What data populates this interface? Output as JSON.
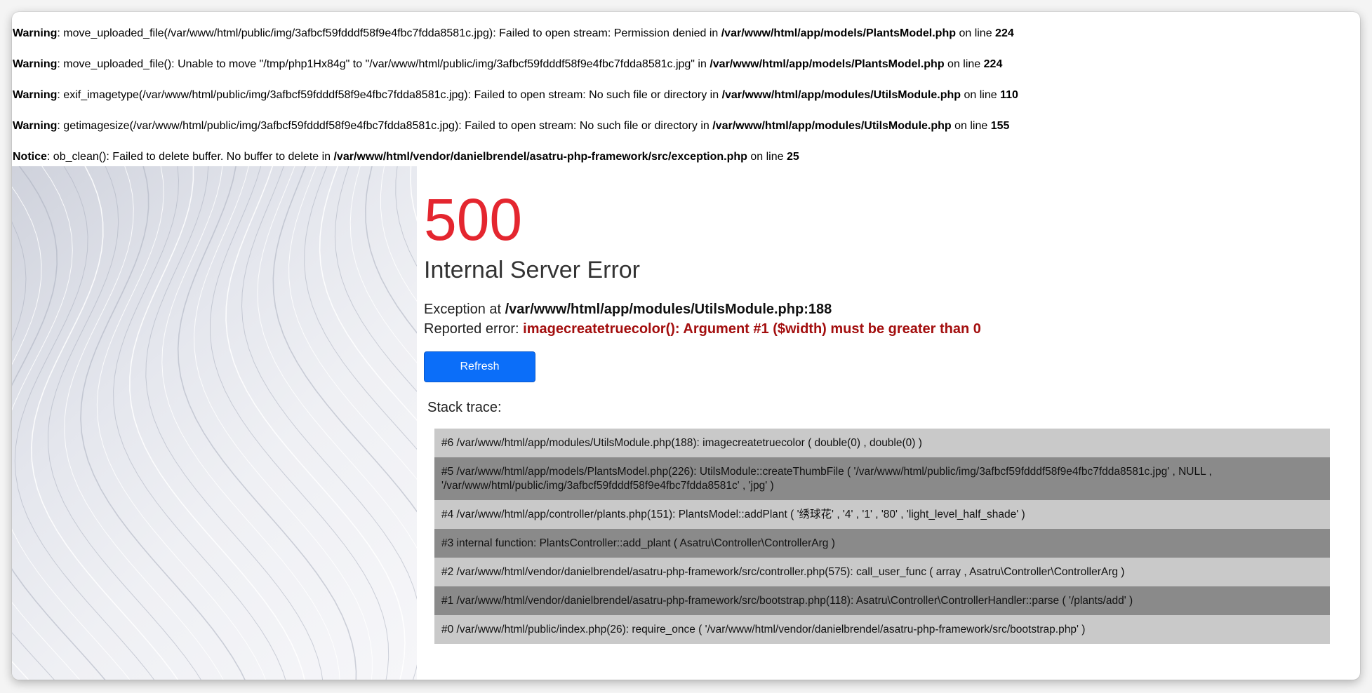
{
  "php_messages": [
    {
      "level": "Warning",
      "text": ": move_uploaded_file(/var/www/html/public/img/3afbcf59fdddf58f9e4fbc7fdda8581c.jpg): Failed to open stream: Permission denied in ",
      "file": "/var/www/html/app/models/PlantsModel.php",
      "on_line": " on line ",
      "line": "224"
    },
    {
      "level": "Warning",
      "text": ": move_uploaded_file(): Unable to move \"/tmp/php1Hx84g\" to \"/var/www/html/public/img/3afbcf59fdddf58f9e4fbc7fdda8581c.jpg\" in ",
      "file": "/var/www/html/app/models/PlantsModel.php",
      "on_line": " on line ",
      "line": "224"
    },
    {
      "level": "Warning",
      "text": ": exif_imagetype(/var/www/html/public/img/3afbcf59fdddf58f9e4fbc7fdda8581c.jpg): Failed to open stream: No such file or directory in ",
      "file": "/var/www/html/app/modules/UtilsModule.php",
      "on_line": " on line ",
      "line": "110"
    },
    {
      "level": "Warning",
      "text": ": getimagesize(/var/www/html/public/img/3afbcf59fdddf58f9e4fbc7fdda8581c.jpg): Failed to open stream: No such file or directory in ",
      "file": "/var/www/html/app/modules/UtilsModule.php",
      "on_line": " on line ",
      "line": "155"
    },
    {
      "level": "Notice",
      "text": ": ob_clean(): Failed to delete buffer. No buffer to delete in ",
      "file": "/var/www/html/vendor/danielbrendel/asatru-php-framework/src/exception.php",
      "on_line": " on line ",
      "line": "25"
    }
  ],
  "error": {
    "code": "500",
    "title": "Internal Server Error",
    "exception_prefix": "Exception at ",
    "exception_location": "/var/www/html/app/modules/UtilsModule.php:188",
    "reported_prefix": "Reported error: ",
    "reported_message": "imagecreatetruecolor(): Argument #1 ($width) must be greater than 0",
    "refresh_label": "Refresh",
    "stack_label": "Stack trace:"
  },
  "stack_trace": [
    {
      "text": "#6 /var/www/html/app/modules/UtilsModule.php(188): imagecreatetruecolor ( double(0) , double(0) )",
      "shade": "light"
    },
    {
      "text": "#5 /var/www/html/app/models/PlantsModel.php(226): UtilsModule::createThumbFile ( '/var/www/html/public/img/3afbcf59fdddf58f9e4fbc7fdda8581c.jpg' , NULL , '/var/www/html/public/img/3afbcf59fdddf58f9e4fbc7fdda8581c' , 'jpg' )",
      "shade": "dark"
    },
    {
      "text": "#4 /var/www/html/app/controller/plants.php(151): PlantsModel::addPlant ( '绣球花' , '4' , '1' , '80' , 'light_level_half_shade' )",
      "shade": "light"
    },
    {
      "text": "#3 internal function: PlantsController::add_plant ( Asatru\\Controller\\ControllerArg )",
      "shade": "dark"
    },
    {
      "text": "#2 /var/www/html/vendor/danielbrendel/asatru-php-framework/src/controller.php(575): call_user_func ( array , Asatru\\Controller\\ControllerArg )",
      "shade": "light"
    },
    {
      "text": "#1 /var/www/html/vendor/danielbrendel/asatru-php-framework/src/bootstrap.php(118): Asatru\\Controller\\ControllerHandler::parse ( '/plants/add' )",
      "shade": "dark"
    },
    {
      "text": "#0 /var/www/html/public/index.php(26): require_once ( '/var/www/html/vendor/danielbrendel/asatru-php-framework/src/bootstrap.php' )",
      "shade": "light"
    }
  ],
  "colors": {
    "error_code": "#e4262f",
    "reported_error": "#a30e0e",
    "refresh_button": "#0b6ef9",
    "frame_light": "#c9c9c9",
    "frame_dark": "#8a8a8a"
  }
}
